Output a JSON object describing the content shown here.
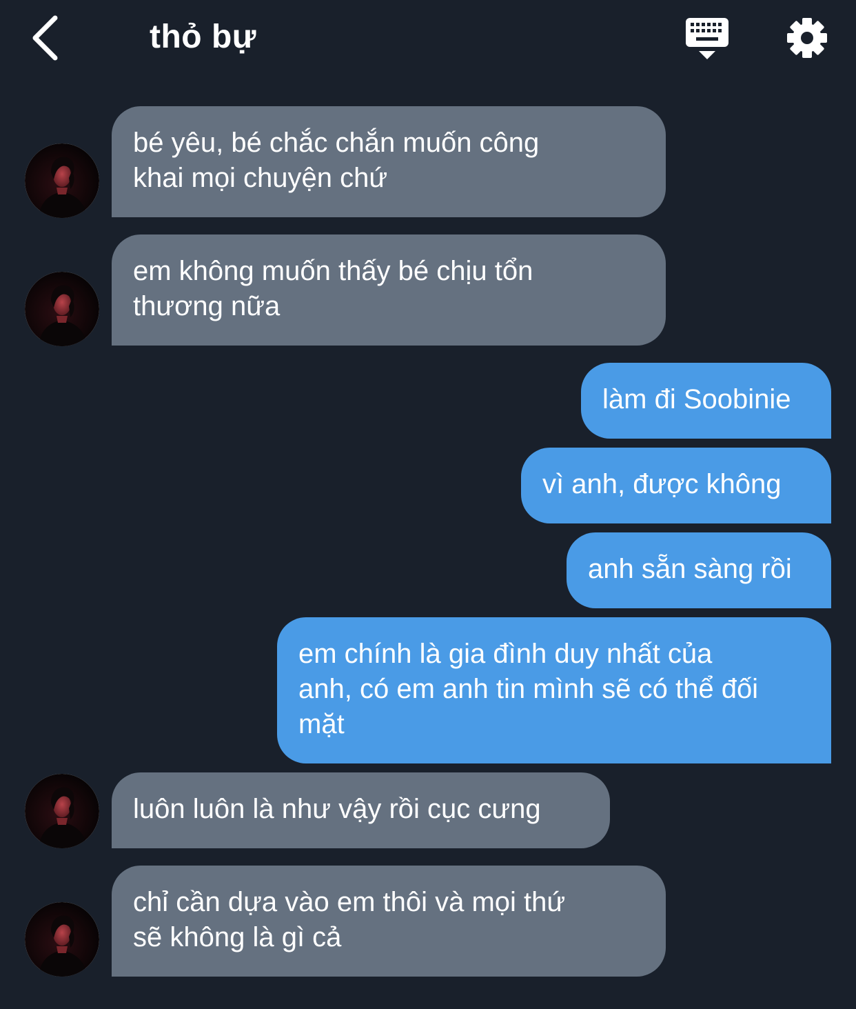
{
  "header": {
    "title": "thỏ bự",
    "back_icon": "chevron-left-icon",
    "keyboard_icon": "keyboard-hide-icon",
    "settings_icon": "gear-icon"
  },
  "colors": {
    "background": "#19202b",
    "incoming_bubble": "#657180",
    "outgoing_bubble": "#4a9be6",
    "text": "#ffffff"
  },
  "messages": [
    {
      "sender": "other",
      "text": "bé yêu, bé chắc chắn muốn công\nkhai mọi chuyện chứ"
    },
    {
      "sender": "other",
      "text": "em không muốn thấy bé chịu tổn\nthương nữa"
    },
    {
      "sender": "me",
      "text": "làm đi Soobinie"
    },
    {
      "sender": "me",
      "text": "vì anh, được không"
    },
    {
      "sender": "me",
      "text": "anh sẵn sàng rồi"
    },
    {
      "sender": "me",
      "text": "em chính là gia đình duy nhất của\nanh, có em anh tin mình sẽ có thể đối\nmặt"
    },
    {
      "sender": "other",
      "text": "luôn luôn là như vậy rồi cục cưng"
    },
    {
      "sender": "other",
      "text": "chỉ cần dựa vào em thôi và mọi thứ\nsẽ không là gì cả"
    }
  ]
}
